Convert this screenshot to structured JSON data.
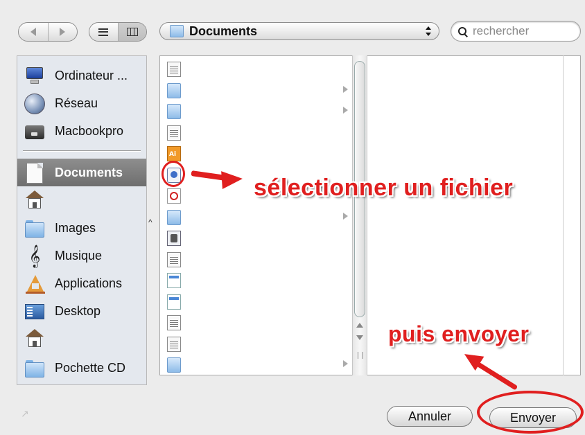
{
  "toolbar": {
    "path_label": "Documents",
    "search_placeholder": "rechercher"
  },
  "sidebar": {
    "devices": [
      {
        "label": "Ordinateur ...",
        "icon": "computer-icon"
      },
      {
        "label": "Réseau",
        "icon": "network-globe-icon"
      },
      {
        "label": "Macbookpro",
        "icon": "hard-drive-icon"
      }
    ],
    "places": [
      {
        "label": "Documents",
        "icon": "documents-icon",
        "selected": true
      },
      {
        "label": "",
        "icon": "home-icon"
      },
      {
        "label": "Images",
        "icon": "folder-icon"
      },
      {
        "label": "Musique",
        "icon": "music-note-icon"
      },
      {
        "label": "Applications",
        "icon": "applications-icon"
      },
      {
        "label": "Desktop",
        "icon": "desktop-icon"
      },
      {
        "label": "",
        "icon": "home-icon"
      },
      {
        "label": "Pochette CD",
        "icon": "folder-icon"
      }
    ]
  },
  "browser": {
    "column1_files": [
      {
        "type": "image-doc",
        "has_children": false
      },
      {
        "type": "folder",
        "has_children": true
      },
      {
        "type": "folder",
        "has_children": true
      },
      {
        "type": "document",
        "has_children": false
      },
      {
        "type": "illustrator",
        "has_children": false
      },
      {
        "type": "application",
        "has_children": false,
        "highlighted": true
      },
      {
        "type": "pdf",
        "has_children": false
      },
      {
        "type": "folder",
        "has_children": true
      },
      {
        "type": "settings-doc",
        "has_children": false
      },
      {
        "type": "document",
        "has_children": false
      },
      {
        "type": "sheet",
        "has_children": false
      },
      {
        "type": "sheet",
        "has_children": false
      },
      {
        "type": "document",
        "has_children": false
      },
      {
        "type": "document",
        "has_children": false
      },
      {
        "type": "folder",
        "has_children": true
      }
    ]
  },
  "annotations": {
    "select_file": "sélectionner un fichier",
    "then_send": "puis envoyer",
    "color": "#e01f1f"
  },
  "buttons": {
    "cancel": "Annuler",
    "send": "Envoyer"
  },
  "colors": {
    "sidebar_bg": "#e4e8ee",
    "selection": "#7a7a7a",
    "annotation_red": "#e01f1f"
  }
}
